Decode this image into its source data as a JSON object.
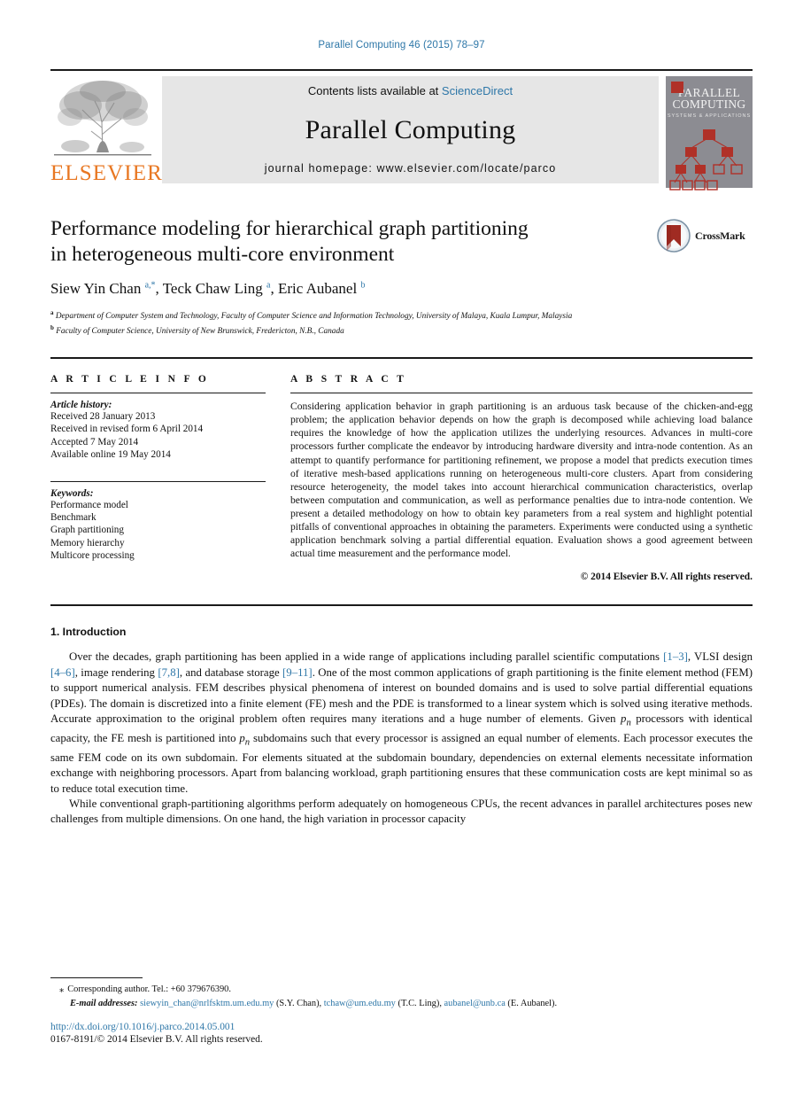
{
  "running_head": "Parallel Computing 46 (2015) 78–97",
  "masthead": {
    "elsevier_wordmark": "ELSEVIER",
    "contents_prefix": "Contents lists available at ",
    "sciencedirect": "ScienceDirect",
    "journal_title": "Parallel Computing",
    "homepage": "journal homepage: www.elsevier.com/locate/parco",
    "cover": {
      "line1": "PARALLEL",
      "line2": "COMPUTING",
      "subtitle": "SYSTEMS & APPLICATIONS"
    }
  },
  "article": {
    "title_line1": "Performance modeling for hierarchical graph partitioning",
    "title_line2": "in heterogeneous multi-core environment",
    "crossmark_label": "CrossMark",
    "authors_html": "Siew Yin Chan <sup>a,*</sup>, Teck Chaw Ling <sup>a</sup>, Eric Aubanel <sup>b</sup>",
    "affiliation_a": "Department of Computer System and Technology, Faculty of Computer Science and Information Technology, University of Malaya, Kuala Lumpur, Malaysia",
    "affiliation_b": "Faculty of Computer Science, University of New Brunswick, Fredericton, N.B., Canada"
  },
  "article_info": {
    "label": "A R T I C L E     I N F O",
    "history_heading": "Article history:",
    "history": [
      "Received 28 January 2013",
      "Received in revised form 6 April 2014",
      "Accepted 7 May 2014",
      "Available online 19 May 2014"
    ],
    "keywords_heading": "Keywords:",
    "keywords": [
      "Performance model",
      "Benchmark",
      "Graph partitioning",
      "Memory hierarchy",
      "Multicore processing"
    ]
  },
  "abstract": {
    "label": "A B S T R A C T",
    "text": "Considering application behavior in graph partitioning is an arduous task because of the chicken-and-egg problem; the application behavior depends on how the graph is decomposed while achieving load balance requires the knowledge of how the application utilizes the underlying resources. Advances in multi-core processors further complicate the endeavor by introducing hardware diversity and intra-node contention. As an attempt to quantify performance for partitioning refinement, we propose a model that predicts execution times of iterative mesh-based applications running on heterogeneous multi-core clusters. Apart from considering resource heterogeneity, the model takes into account hierarchical communication characteristics, overlap between computation and communication, as well as performance penalties due to intra-node contention. We present a detailed methodology on how to obtain key parameters from a real system and highlight potential pitfalls of conventional approaches in obtaining the parameters. Experiments were conducted using a synthetic application benchmark solving a partial differential equation. Evaluation shows a good agreement between actual time measurement and the performance model.",
    "copyright": "© 2014 Elsevier B.V. All rights reserved."
  },
  "introduction": {
    "heading": "1. Introduction",
    "paragraph1_html": "Over the decades, graph partitioning has been applied in a wide range of applications including parallel scientific computations <span class=\"cite\">[1–3]</span>, VLSI design <span class=\"cite\">[4–6]</span>, image rendering <span class=\"cite\">[7,8]</span>, and database storage <span class=\"cite\">[9–11]</span>. One of the most common applications of graph partitioning is the finite element method (FEM) to support numerical analysis. FEM describes physical phenomena of interest on bounded domains and is used to solve partial differential equations (PDEs). The domain is discretized into a finite element (FE) mesh and the PDE is transformed to a linear system which is solved using iterative methods. Accurate approximation to the original problem often requires many iterations and a huge number of elements. Given <span class=\"math-var\">p<sub>n</sub></span> processors with identical capacity, the FE mesh is partitioned into <span class=\"math-var\">p<sub>n</sub></span> subdomains such that every processor is assigned an equal number of elements. Each processor executes the same FEM code on its own subdomain. For elements situated at the subdomain boundary, dependencies on external elements necessitate information exchange with neighboring processors. Apart from balancing workload, graph partitioning ensures that these communication costs are kept minimal so as to reduce total execution time.",
    "paragraph2_html": "While conventional graph-partitioning algorithms perform adequately on homogeneous CPUs, the recent advances in parallel architectures poses new challenges from multiple dimensions. On one hand, the high variation in processor capacity"
  },
  "footnotes": {
    "corresponding_marker": "⁎",
    "corresponding_text": "Corresponding author. Tel.: +60 379676390.",
    "email_label": "E-mail addresses:",
    "emails_html": "<span class=\"link\">siewyin_chan@nrlfsktm.um.edu.my</span> (S.Y. Chan), <span class=\"link\">tchaw@um.edu.my</span> (T.C. Ling), <span class=\"link\">aubanel@unb.ca</span> (E. Aubanel).",
    "doi": "http://dx.doi.org/10.1016/j.parco.2014.05.001",
    "issn": "0167-8191/© 2014 Elsevier B.V. All rights reserved."
  }
}
